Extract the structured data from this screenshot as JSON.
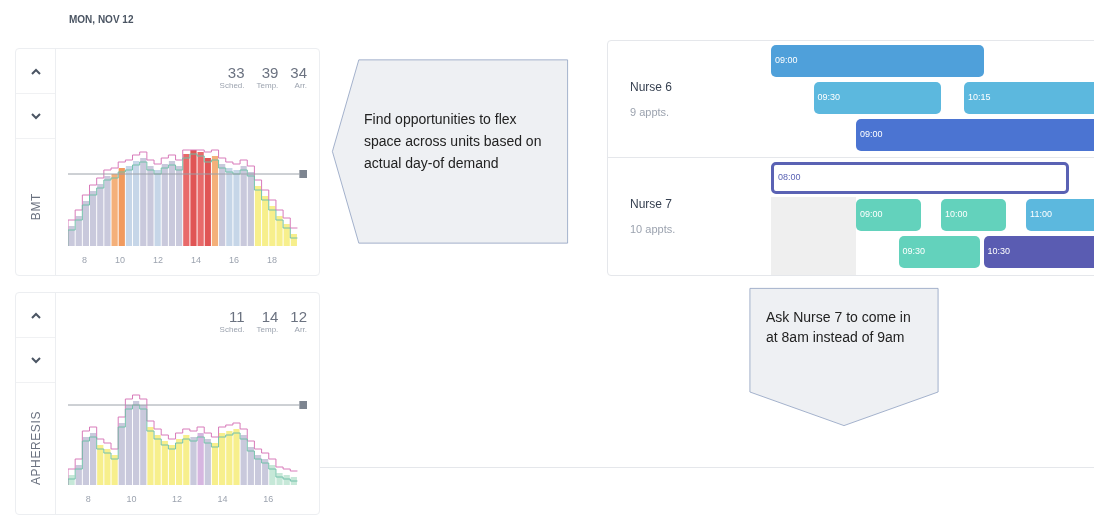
{
  "date": "MON, NOV 12",
  "units": [
    {
      "name": "BMT",
      "stats": [
        {
          "value": "33",
          "label": "Sched."
        },
        {
          "value": "39",
          "label": "Temp."
        },
        {
          "value": "34",
          "label": "Arr."
        }
      ],
      "hours": [
        "8",
        "10",
        "12",
        "14",
        "16",
        "18"
      ],
      "kind": "bmt"
    },
    {
      "name": "APHERESIS",
      "stats": [
        {
          "value": "11",
          "label": "Sched."
        },
        {
          "value": "14",
          "label": "Temp."
        },
        {
          "value": "12",
          "label": "Arr."
        }
      ],
      "hours": [
        "8",
        "10",
        "12",
        "14",
        "16"
      ],
      "kind": "apheresis"
    }
  ],
  "callouts": [
    {
      "kind": "left",
      "text": "Find opportunities to flex space across units based on actual day-of demand"
    },
    {
      "kind": "down",
      "text": "Ask Nurse 7 to come in at 8am instead of 9am"
    }
  ],
  "nurses": [
    {
      "name": "Nurse 6",
      "count": "9 appts.",
      "late_start": false,
      "lanes": [
        [
          {
            "time": "09:00",
            "color": "#4fa0da",
            "kind": "filled"
          }
        ],
        [
          {
            "time": "09:30",
            "color": "#5cb8de",
            "kind": "filled"
          },
          {
            "time": "10:15",
            "color": "#5cb8de",
            "kind": "filled"
          }
        ],
        [
          {
            "time": "09:00",
            "color": "#4b74d2",
            "kind": "filled"
          }
        ]
      ]
    },
    {
      "name": "Nurse 7",
      "count": "10 appts.",
      "late_start": true,
      "lanes": [
        [
          {
            "time": "08:00",
            "color": "#5a62b4",
            "kind": "outline"
          }
        ],
        [
          {
            "time": "09:00",
            "color": "#63d2bc",
            "kind": "filled"
          },
          {
            "time": "10:00",
            "color": "#63d2bc",
            "kind": "filled"
          },
          {
            "time": "11:00",
            "color": "#5cb8de",
            "kind": "filled"
          }
        ],
        [
          {
            "time": "09:30",
            "color": "#63d2bc",
            "kind": "filled"
          },
          {
            "time": "10:30",
            "color": "#5a5cb2",
            "kind": "filled"
          }
        ]
      ]
    }
  ]
}
